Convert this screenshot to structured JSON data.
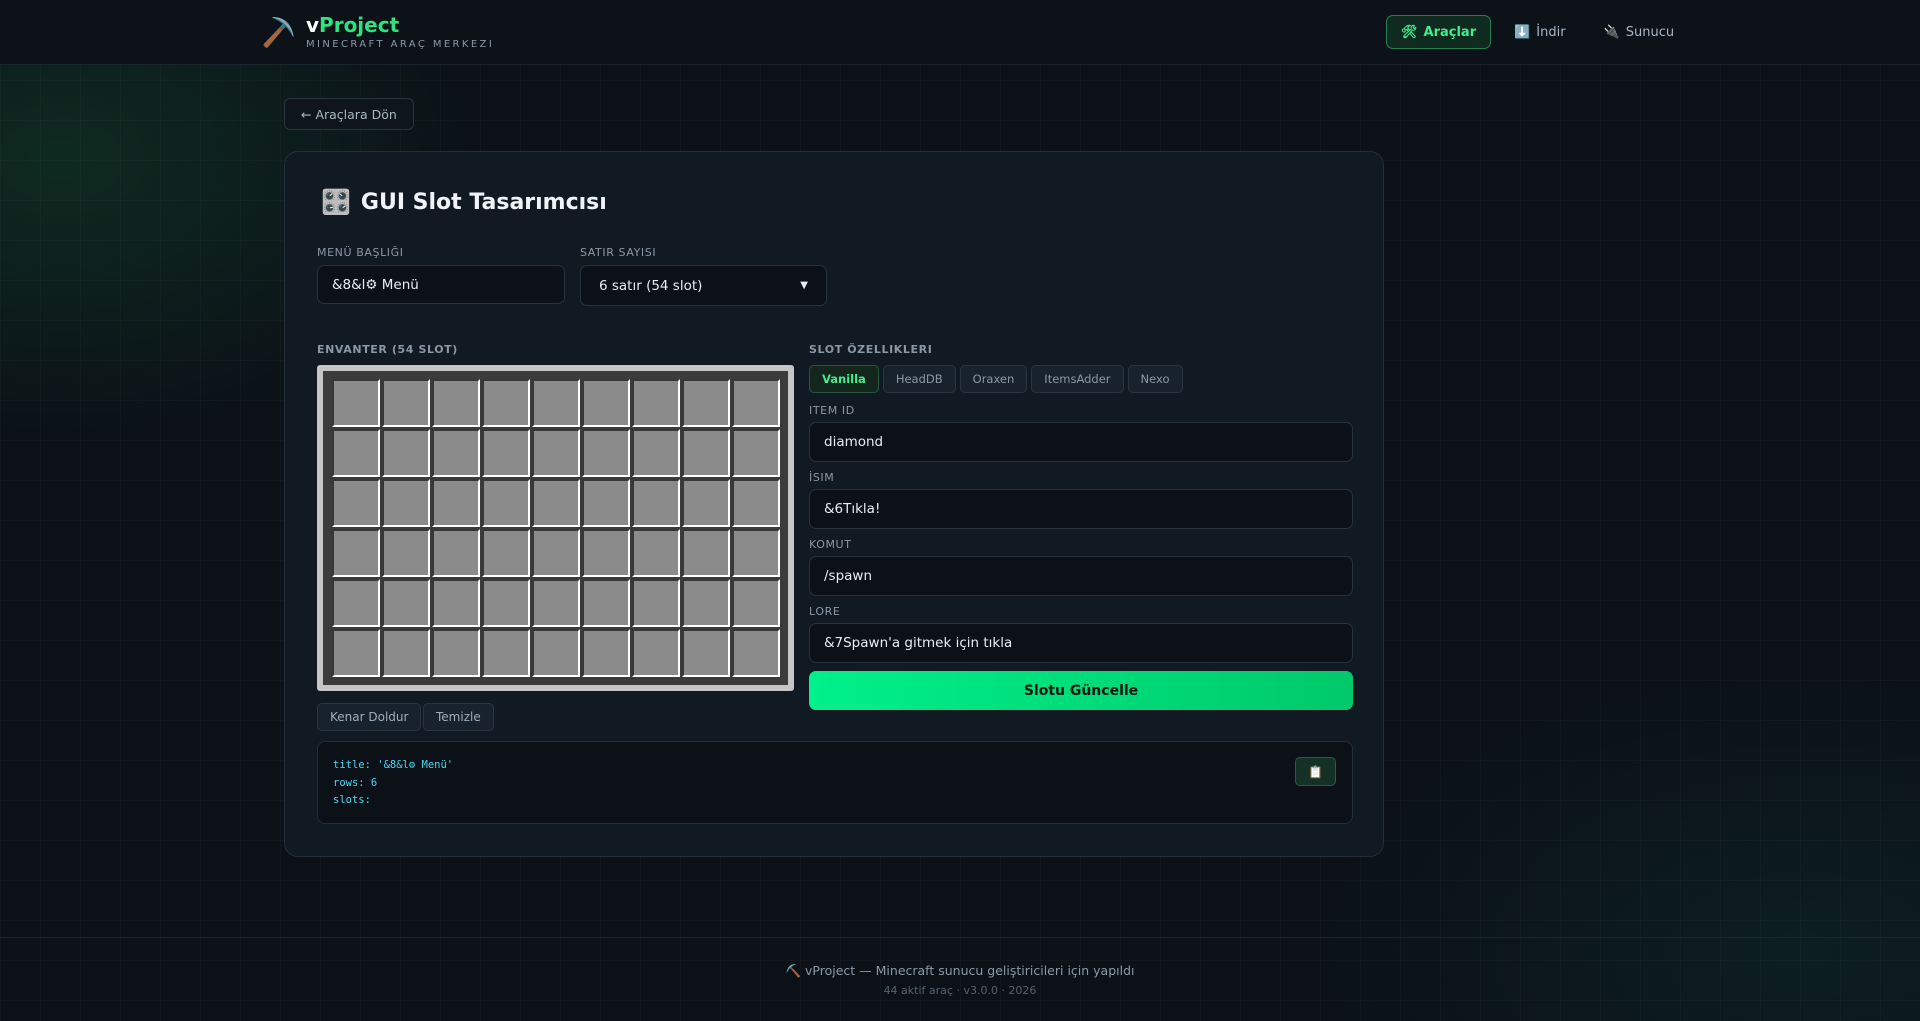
{
  "header": {
    "logo_icon": "⛏️",
    "brand_v": "v",
    "brand_project": "Project",
    "subtitle": "MINECRAFT ARAÇ MERKEZI",
    "nav": [
      {
        "icon": "🛠",
        "label": "Araçlar",
        "active": true
      },
      {
        "icon": "⬇️",
        "label": "İndir",
        "active": false
      },
      {
        "icon": "🔌",
        "label": "Sunucu",
        "active": false
      }
    ]
  },
  "back_button": "← Araçlara Dön",
  "tool": {
    "icon": "🎛️",
    "title": "GUI Slot Tasarımcısı",
    "menu_title_label": "MENÜ BAŞLIĞI",
    "menu_title_value": "&8&l⚙ Menü",
    "rows_label": "SATIR SAYISI",
    "rows_value": "6 satır (54 slot)",
    "inventory_label": "ENVANTER (54 SLOT)",
    "inventory_rows": 6,
    "inventory_cols": 9,
    "fill_border_button": "Kenar Doldur",
    "clear_button": "Temizle",
    "slot_props_label": "SLOT ÖZELLIKLERI",
    "source_tabs": [
      {
        "label": "Vanilla",
        "active": true
      },
      {
        "label": "HeadDB",
        "active": false
      },
      {
        "label": "Oraxen",
        "active": false
      },
      {
        "label": "ItemsAdder",
        "active": false
      },
      {
        "label": "Nexo",
        "active": false
      }
    ],
    "item_id_label": "ITEM ID",
    "item_id_value": "diamond",
    "name_label": "İSIM",
    "name_value": "&6Tıkla!",
    "command_label": "KOMUT",
    "command_value": "/spawn",
    "lore_label": "LORE",
    "lore_value": "&7Spawn'a gitmek için tıkla",
    "update_button": "Slotu Güncelle",
    "code_lines": [
      "title: '&8&l⚙ Menü'",
      "rows: 6",
      "slots:"
    ],
    "copy_icon": "📋"
  },
  "footer": {
    "main": "⛏️ vProject — Minecraft sunucu geliştiricileri için yapıldı",
    "sub": "44 aktif araç · v3.0.0 · 2026"
  }
}
